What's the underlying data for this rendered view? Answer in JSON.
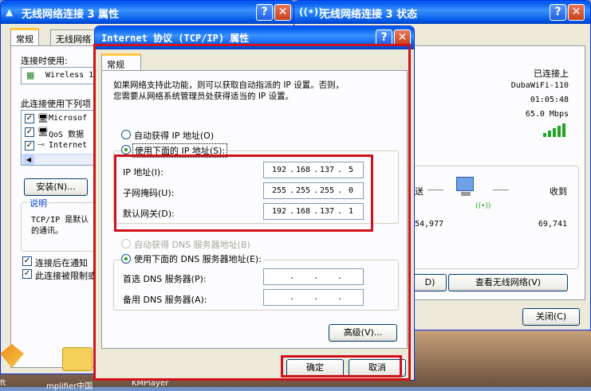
{
  "left_window": {
    "title": "无线网络连接 3 属性",
    "tabs": [
      "常规",
      "无线网络"
    ],
    "connect_using_label": "连接时使用:",
    "adapter_name": "Wireless 1",
    "items_label": "此连接使用下列项",
    "items": [
      "Microsof",
      "QoS 数据",
      "Internet"
    ],
    "install_button": "安装(N)...",
    "description_title": "说明",
    "description_text": [
      "TCP/IP 是默认",
      "的通讯。"
    ],
    "checkbox_notify": "连接后在通知",
    "checkbox_limited": "此连接被限制或"
  },
  "right_window": {
    "title": "无线网络连接 3 状态",
    "status": "已连接上",
    "network": "DubaWiFi-110",
    "duration": "01:05:48",
    "speed": "65.0 Mbps",
    "sent_label": "送",
    "received_label": "收到",
    "sent_value": "54,977",
    "received_value": "69,741",
    "partial_button": "D)",
    "view_networks_button": "查看无线网络(V)",
    "close_button": "关闭(C)"
  },
  "tcpip_dialog": {
    "title": "Internet 协议 (TCP/IP) 属性",
    "tab": "常规",
    "intro_line1": "如果网络支持此功能，则可以获取自动指派的 IP 设置。否则，",
    "intro_line2": "您需要从网络系统管理员处获得适当的 IP 设置。",
    "auto_ip_label": "自动获得 IP 地址(O)",
    "manual_ip_label": "使用下面的 IP 地址(S):",
    "ip_label": "IP 地址(I):",
    "subnet_label": "子网掩码(U):",
    "gateway_label": "默认网关(D):",
    "ip_address": [
      "192",
      "168",
      "137",
      "5"
    ],
    "subnet_mask": [
      "255",
      "255",
      "255",
      "0"
    ],
    "gateway": [
      "192",
      "168",
      "137",
      "1"
    ],
    "auto_dns_label": "自动获得 DNS 服务器地址(B)",
    "manual_dns_label": "使用下面的 DNS 服务器地址(E):",
    "preferred_dns_label": "首选 DNS 服务器(P):",
    "alternate_dns_label": "备用 DNS 服务器(A):",
    "advanced_button": "高级(V)...",
    "ok_button": "确定",
    "cancel_button": "取消"
  },
  "taskbar_fragments": [
    "ft",
    "mplifier中国",
    "KMPlayer"
  ],
  "colors": {
    "title_blue": "#0054e3",
    "highlight_red": "#d0111b",
    "dialog_bg": "#ece9d8"
  }
}
